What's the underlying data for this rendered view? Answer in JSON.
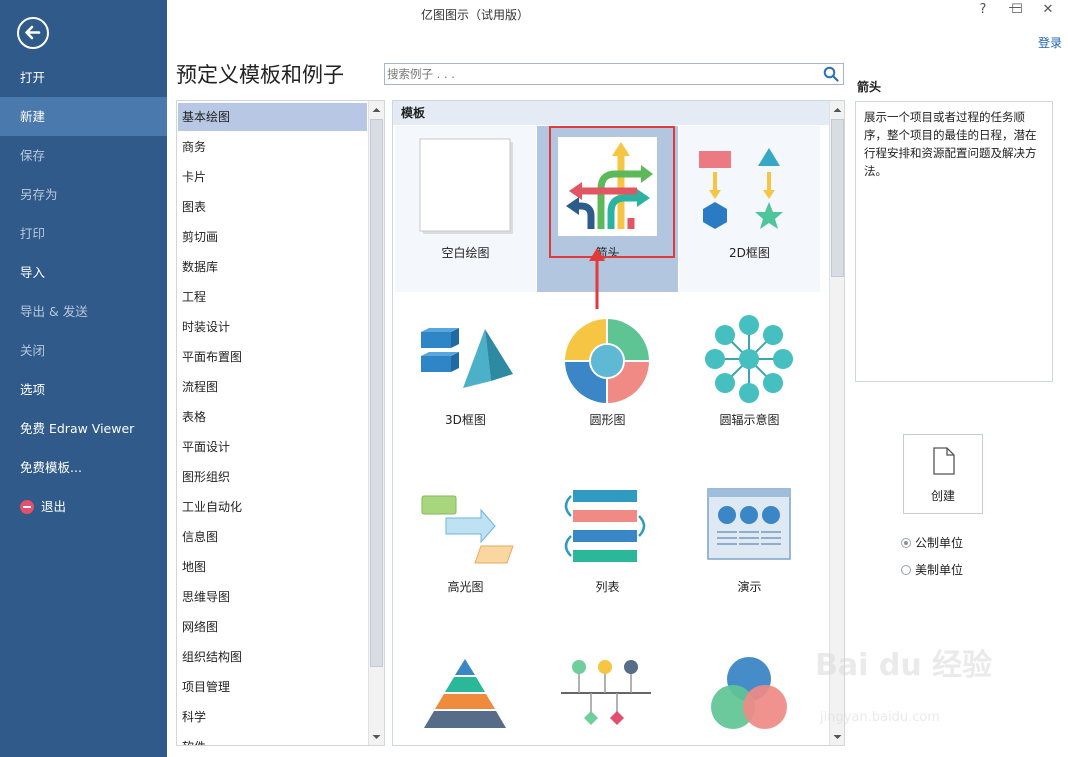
{
  "window": {
    "title": "亿图图示（试用版）",
    "login": "登录",
    "controls": {
      "help": "?",
      "minimize": "—",
      "maximize": "☐",
      "close": "✕"
    }
  },
  "sidebar": {
    "items": [
      {
        "label": "打开",
        "enabled": true
      },
      {
        "label": "新建",
        "enabled": true,
        "active": true
      },
      {
        "label": "保存",
        "enabled": false
      },
      {
        "label": "另存为",
        "enabled": false
      },
      {
        "label": "打印",
        "enabled": false
      },
      {
        "label": "导入",
        "enabled": true
      },
      {
        "label": "导出 & 发送",
        "enabled": false
      },
      {
        "label": "关闭",
        "enabled": false
      },
      {
        "label": "选项",
        "enabled": true
      },
      {
        "label": "免费 Edraw Viewer",
        "enabled": true
      },
      {
        "label": "免费模板...",
        "enabled": true
      },
      {
        "label": "退出",
        "enabled": true
      }
    ]
  },
  "page_title": "预定义模板和例子",
  "search": {
    "placeholder": "搜索例子 . . ."
  },
  "categories": [
    "基本绘图",
    "商务",
    "卡片",
    "图表",
    "剪切画",
    "数据库",
    "工程",
    "时装设计",
    "平面布置图",
    "流程图",
    "表格",
    "平面设计",
    "图形组织",
    "工业自动化",
    "信息图",
    "地图",
    "思维导图",
    "网络图",
    "组织结构图",
    "项目管理",
    "科学",
    "软件"
  ],
  "selected_category": "基本绘图",
  "templates": {
    "header": "模板",
    "tiles": [
      {
        "label": "空白绘图",
        "icon": "blank-page-icon"
      },
      {
        "label": "箭头",
        "icon": "arrows-icon",
        "selected": true
      },
      {
        "label": "2D框图",
        "icon": "2d-block-icon"
      },
      {
        "label": "3D框图",
        "icon": "3d-block-icon"
      },
      {
        "label": "圆形图",
        "icon": "circle-diagram-icon"
      },
      {
        "label": "圆辐示意图",
        "icon": "radial-diagram-icon"
      },
      {
        "label": "高光图",
        "icon": "highlight-diagram-icon"
      },
      {
        "label": "列表",
        "icon": "list-icon"
      },
      {
        "label": "演示",
        "icon": "presentation-icon"
      },
      {
        "label": "",
        "icon": "pyramid-icon"
      },
      {
        "label": "",
        "icon": "timeline-icon"
      },
      {
        "label": "",
        "icon": "venn-icon"
      }
    ]
  },
  "description": {
    "title": "箭头",
    "text": "展示一个项目或者过程的任务顺序，整个项目的最佳的日程，潜在行程安排和资源配置问题及解决方法。"
  },
  "create_button": "创建",
  "units": {
    "options": [
      "公制单位",
      "美制单位"
    ],
    "selected": "公制单位"
  },
  "watermark": {
    "text": "Bai du 经验",
    "url": "jingyan.baidu.com"
  },
  "colors": {
    "sidebar": "#2f5a8a",
    "sidebar_active": "#4a79ad",
    "selection": "#b8c7e3",
    "highlight": "#e23a3a"
  }
}
